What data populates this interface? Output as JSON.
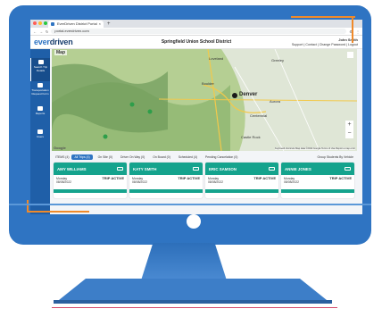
{
  "browser": {
    "tab_title": "EverDriven District Portal",
    "tab_close": "×",
    "new_tab": "+",
    "url": "portal.everdriven.com",
    "nav_back": "←",
    "nav_forward": "→",
    "nav_reload": "↻"
  },
  "header": {
    "logo_part1": "ever",
    "logo_part2": "driven",
    "district": "Springfield Union School District",
    "user_name": "John Smith",
    "user_links": "Support | Contact | Change Password | Logout"
  },
  "sidebar": {
    "items": [
      {
        "label": "Search Trip Details"
      },
      {
        "label": "Transportation Request Form"
      },
      {
        "label": "Reports"
      },
      {
        "label": "Users"
      }
    ]
  },
  "map": {
    "label": "Map",
    "places": [
      "Loveland",
      "Greeley",
      "Boulder",
      "Denver",
      "Aurora",
      "Centennial",
      "Castle Rock"
    ],
    "zoom_in": "+",
    "zoom_out": "−",
    "brand": "Google",
    "attribution": "Keyboard shortcuts   Map data ©2022 Google   Terms of Use   Report a map error"
  },
  "filters": {
    "count": "ITEMS (4)",
    "chips": [
      "All Trips (4)",
      "On Site (0)",
      "Driver On Way (0)",
      "On Board (0)",
      "Scheduled (4)",
      "Pending Cancelation (0)"
    ],
    "active_index": 0,
    "sort_label": "Group Students By Vehicle"
  },
  "cards": [
    {
      "name": "AMY WILLIAMS",
      "day": "Monday",
      "date": "08/08/2022",
      "status": "TRIP ACTIVE"
    },
    {
      "name": "KATY SMITH",
      "day": "Monday",
      "date": "08/08/2022",
      "status": "TRIP ACTIVE"
    },
    {
      "name": "ERIC SAMSON",
      "day": "Monday",
      "date": "08/08/2022",
      "status": "TRIP ACTIVE"
    },
    {
      "name": "ANNIE JONES",
      "day": "Monday",
      "date": "08/08/2022",
      "status": "TRIP ACTIVE"
    }
  ],
  "colors": {
    "monitor": "#2f74c2",
    "accent": "#f08a2a",
    "card_header": "#15a38d",
    "sidebar": "#1f5fa8"
  }
}
